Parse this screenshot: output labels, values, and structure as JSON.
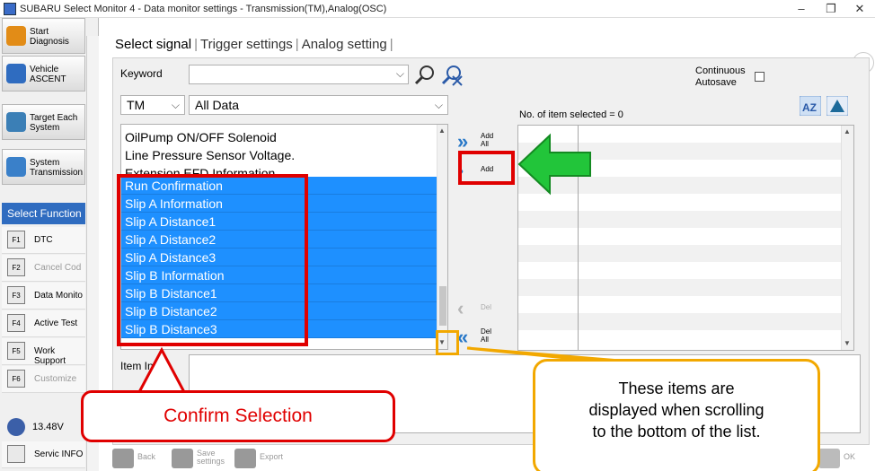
{
  "window": {
    "title": "SUBARU Select Monitor 4 - Data monitor settings - Transmission(TM),Analog(OSC)",
    "minimize": "–",
    "restore": "❐",
    "close": "✕"
  },
  "sidebar": {
    "nav": [
      {
        "label": "Start Diagnosis",
        "color": "#e28c17"
      },
      {
        "label": "Vehicle ASCENT",
        "color": "#2f6cc0"
      },
      {
        "label": "Target Each System",
        "color": "#3b7fb6"
      },
      {
        "label": "System Transmission",
        "color": "#3a80c9"
      }
    ],
    "select_function": "Select Function",
    "functions": [
      {
        "icon": "F1",
        "label": "DTC",
        "enabled": true
      },
      {
        "icon": "F2",
        "label": "Cancel Cod",
        "enabled": false
      },
      {
        "icon": "F3",
        "label": "Data Monito",
        "enabled": true
      },
      {
        "icon": "F4",
        "label": "Active Test",
        "enabled": true
      },
      {
        "icon": "F5",
        "label": "Work Support",
        "enabled": true
      },
      {
        "icon": "F6",
        "label": "Customize",
        "enabled": false
      }
    ],
    "voltage": "13.48V",
    "service_info": "Servic INFO"
  },
  "tabs": {
    "select_signal": "Select signal",
    "trigger_settings": "Trigger settings",
    "analog_setting": "Analog setting"
  },
  "keyword": {
    "label": "Keyword",
    "value": ""
  },
  "continuous_autosave": {
    "label_line1": "Continuous",
    "label_line2": "Autosave",
    "checked": false
  },
  "filters": {
    "system": "TM",
    "category": "All Data"
  },
  "signal_list": {
    "items": [
      {
        "label": "OilPump ON/OFF Solenoid",
        "selected": false
      },
      {
        "label": "Line Pressure Sensor Voltage.",
        "selected": false
      },
      {
        "label": "Extension EFD Information",
        "selected": false
      },
      {
        "label": "Run Confirmation",
        "selected": true
      },
      {
        "label": "Slip A Information",
        "selected": true
      },
      {
        "label": "Slip A Distance1",
        "selected": true
      },
      {
        "label": "Slip A Distance2",
        "selected": true
      },
      {
        "label": "Slip A Distance3",
        "selected": true
      },
      {
        "label": "Slip B Information",
        "selected": true
      },
      {
        "label": "Slip B Distance1",
        "selected": true
      },
      {
        "label": "Slip B Distance2",
        "selected": true
      },
      {
        "label": "Slip B Distance3",
        "selected": true
      }
    ]
  },
  "move_buttons": {
    "add_all": "Add All",
    "add": "Add",
    "del": "Del",
    "del_all": "Del All"
  },
  "selected_count": "No. of item selected = 0",
  "item_info_label": "Item Info",
  "bottom": {
    "back": "Back",
    "save_settings": "Save settings",
    "export": "Export",
    "ok": "OK"
  },
  "annotations": {
    "confirm_selection": "Confirm Selection",
    "scroll_note_line1": "These items are",
    "scroll_note_line2": "displayed when scrolling",
    "scroll_note_line3": "to the bottom of the list.",
    "red": "#e00000",
    "orange": "#f2a800",
    "green": "#22c53a"
  },
  "colors": {
    "selection": "#1e90ff",
    "accent": "#2878c8",
    "sidebar_header": "#2f6cc0"
  }
}
